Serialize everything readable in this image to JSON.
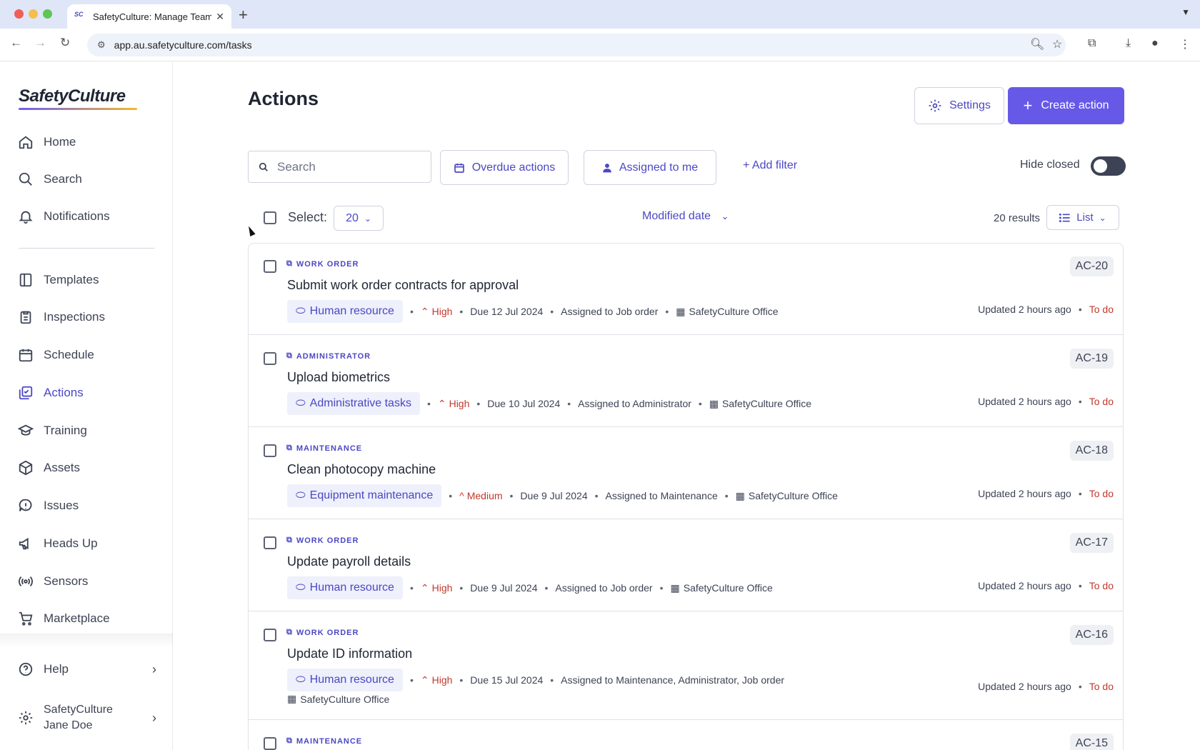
{
  "browser": {
    "tab_title": "SafetyCulture: Manage Teams",
    "url": "app.au.safetyculture.com/tasks",
    "traffic_colors": [
      "#ee5f57",
      "#f5be4f",
      "#5fc554"
    ]
  },
  "sidebar": {
    "logo": "SafetyCulture",
    "items": [
      {
        "label": "Home",
        "icon": "home-icon"
      },
      {
        "label": "Search",
        "icon": "search-icon"
      },
      {
        "label": "Notifications",
        "icon": "bell-icon"
      },
      {
        "label": "Templates",
        "icon": "templates-icon"
      },
      {
        "label": "Inspections",
        "icon": "clipboard-icon"
      },
      {
        "label": "Schedule",
        "icon": "calendar-icon"
      },
      {
        "label": "Actions",
        "icon": "actions-icon",
        "active": true
      },
      {
        "label": "Training",
        "icon": "graduation-icon"
      },
      {
        "label": "Assets",
        "icon": "cube-icon"
      },
      {
        "label": "Issues",
        "icon": "alert-icon"
      },
      {
        "label": "Heads Up",
        "icon": "megaphone-icon"
      },
      {
        "label": "Sensors",
        "icon": "sensor-icon"
      },
      {
        "label": "Marketplace",
        "icon": "cart-icon"
      }
    ],
    "help": "Help",
    "org_name": "SafetyCulture",
    "user_name": "Jane Doe"
  },
  "main": {
    "title": "Actions",
    "settings_label": "Settings",
    "create_label": "Create action",
    "search_placeholder": "Search",
    "overdue_label": "Overdue actions",
    "assigned_label": "Assigned to me",
    "add_filter_label": "+ Add filter",
    "hide_closed_label": "Hide closed",
    "hide_closed_on": false,
    "select_label": "Select:",
    "select_count": "20",
    "sort_label": "Modified date",
    "results_label": "20 results",
    "view_label": "List"
  },
  "actions": [
    {
      "type": "WORK ORDER",
      "title": "Submit work order contracts for approval",
      "label": "Human resource",
      "priority": "High",
      "due": "Due 12 Jul 2024",
      "assigned": "Assigned to Job order",
      "site": "SafetyCulture Office",
      "code": "AC-20",
      "updated": "Updated 2 hours ago",
      "status": "To do"
    },
    {
      "type": "ADMINISTRATOR",
      "title": "Upload biometrics",
      "label": "Administrative tasks",
      "priority": "High",
      "due": "Due 10 Jul 2024",
      "assigned": "Assigned to Administrator",
      "site": "SafetyCulture Office",
      "code": "AC-19",
      "updated": "Updated 2 hours ago",
      "status": "To do"
    },
    {
      "type": "MAINTENANCE",
      "title": "Clean photocopy machine",
      "label": "Equipment maintenance",
      "priority": "Medium",
      "due": "Due 9 Jul 2024",
      "assigned": "Assigned to Maintenance",
      "site": "SafetyCulture Office",
      "code": "AC-18",
      "updated": "Updated 2 hours ago",
      "status": "To do"
    },
    {
      "type": "WORK ORDER",
      "title": "Update payroll details",
      "label": "Human resource",
      "priority": "High",
      "due": "Due 9 Jul 2024",
      "assigned": "Assigned to Job order",
      "site": "SafetyCulture Office",
      "code": "AC-17",
      "updated": "Updated 2 hours ago",
      "status": "To do"
    },
    {
      "type": "WORK ORDER",
      "title": "Update ID information",
      "label": "Human resource",
      "priority": "High",
      "due": "Due 15 Jul 2024",
      "assigned": "Assigned to Maintenance, Administrator, Job order",
      "site": "SafetyCulture Office",
      "code": "AC-16",
      "updated": "Updated 2 hours ago",
      "status": "To do"
    },
    {
      "type": "MAINTENANCE",
      "title": "",
      "code": "AC-15"
    }
  ]
}
